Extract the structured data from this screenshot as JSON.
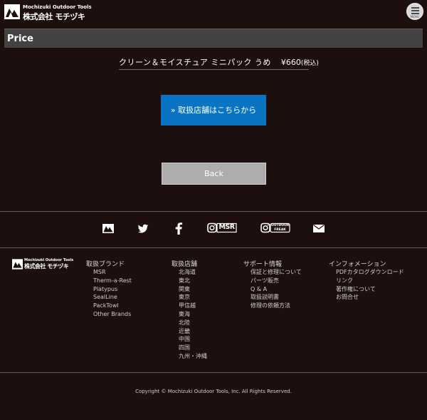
{
  "header": {
    "logo_en": "Mochizuki Outdoor Tools",
    "logo_jp": "株式会社 モチヅキ",
    "menu_label": "MENU"
  },
  "price_section": {
    "title": "Price",
    "product_name": "クリーン＆モイスチュア ミニパック うめ",
    "price": "¥660",
    "tax_note": "(税込)"
  },
  "buttons": {
    "stores": "» 取扱店舗はこちらから",
    "back": "Back"
  },
  "social_icons": [
    "mochizuki-logo-icon",
    "twitter-icon",
    "facebook-icon",
    "instagram-msr-icon",
    "instagram-outdoor-freak-icon",
    "mail-icon"
  ],
  "social_labels": {
    "msr": "MSR",
    "outdoor_freak_top": "OUTDOOR",
    "outdoor_freak_bottom": "FREAK"
  },
  "footer": {
    "logo_en": "Mochizuki Outdoor Tools",
    "logo_jp": "株式会社 モチヅキ",
    "columns": [
      {
        "heading": "取扱ブランド",
        "items": [
          "MSR",
          "Therm-a-Rest",
          "Platypus",
          "SealLine",
          "PackTowl",
          "Other Brands"
        ]
      },
      {
        "heading": "取扱店舗",
        "items": [
          "北海道",
          "東北",
          "関東",
          "東京",
          "甲信越",
          "東海",
          "北陸",
          "近畿",
          "中国",
          "四国",
          "九州・沖縄"
        ]
      },
      {
        "heading": "サポート情報",
        "items": [
          "保証と修理について",
          "パーツ販売",
          "Q & A",
          "取扱説明書",
          "修理の依頼方法"
        ]
      },
      {
        "heading": "インフォメーション",
        "items": [
          "PDFカタログダウンロード",
          "リンク",
          "著作権について",
          "お問合せ"
        ]
      }
    ],
    "copyright": "Copyright © Mochizuki Outdoor Tools, Inc. All Rights Reserved."
  }
}
